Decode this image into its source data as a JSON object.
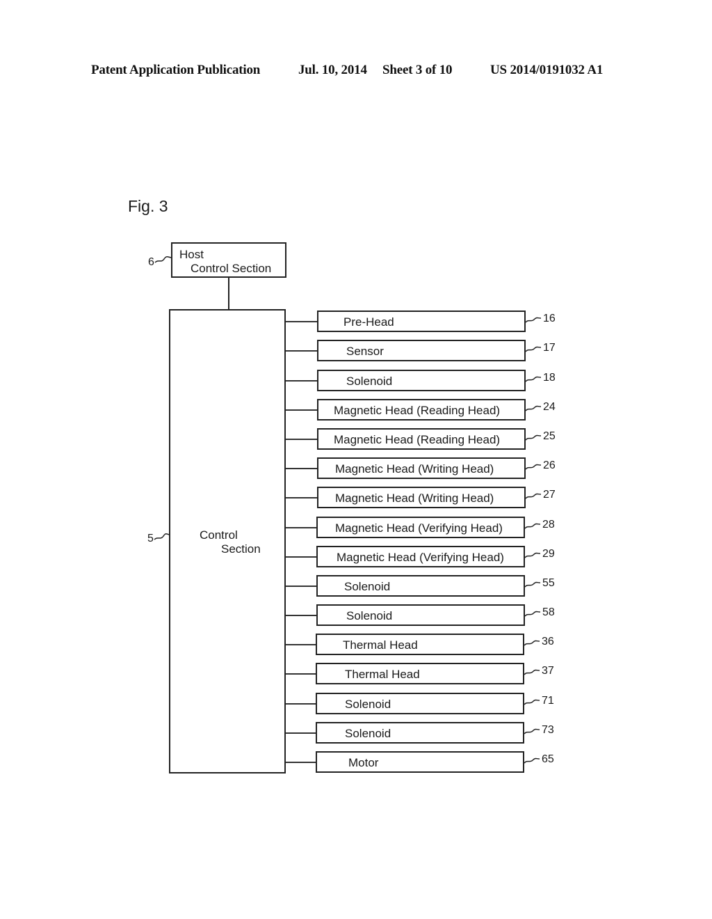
{
  "header": {
    "publication": "Patent Application Publication",
    "date": "Jul. 10, 2014",
    "sheet": "Sheet 3 of 10",
    "number": "US 2014/0191032 A1"
  },
  "figure": {
    "title": "Fig. 3",
    "host": {
      "ref": "6",
      "line1": "Host",
      "line2": "Control Section"
    },
    "control": {
      "ref": "5",
      "line1": "Control",
      "line2": "Section"
    },
    "components": [
      {
        "label": "Pre-Head",
        "ref": "16"
      },
      {
        "label": "Sensor",
        "ref": "17"
      },
      {
        "label": "Solenoid",
        "ref": "18"
      },
      {
        "label": "Magnetic Head (Reading Head)",
        "ref": "24"
      },
      {
        "label": "Magnetic Head (Reading Head)",
        "ref": "25"
      },
      {
        "label": "Magnetic Head (Writing Head)",
        "ref": "26"
      },
      {
        "label": "Magnetic Head (Writing Head)",
        "ref": "27"
      },
      {
        "label": "Magnetic Head (Verifying Head)",
        "ref": "28"
      },
      {
        "label": "Magnetic Head (Verifying Head)",
        "ref": "29"
      },
      {
        "label": "Solenoid",
        "ref": "55"
      },
      {
        "label": "Solenoid",
        "ref": "58"
      },
      {
        "label": "Thermal Head",
        "ref": "36"
      },
      {
        "label": "Thermal Head",
        "ref": "37"
      },
      {
        "label": "Solenoid",
        "ref": "71"
      },
      {
        "label": "Solenoid",
        "ref": "73"
      },
      {
        "label": "Motor",
        "ref": "65"
      }
    ]
  }
}
